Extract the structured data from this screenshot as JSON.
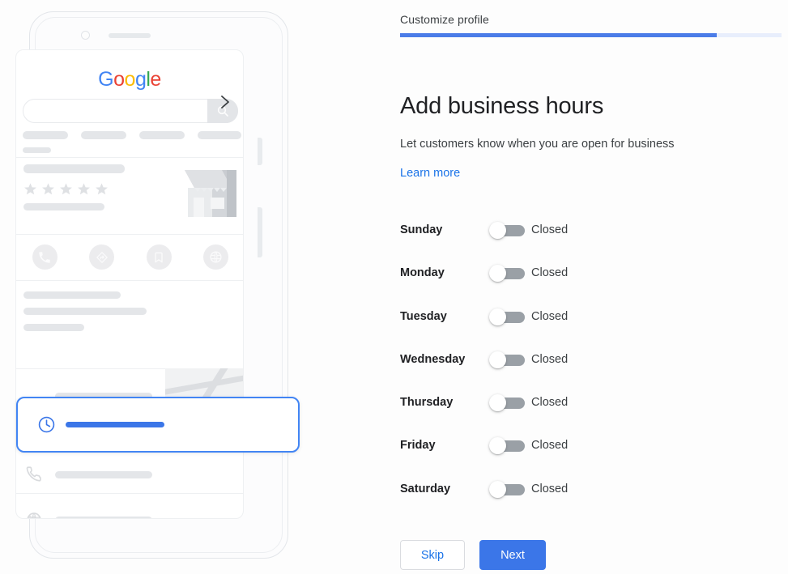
{
  "wizard": {
    "eyebrow": "Customize profile",
    "progress_percent": 83,
    "title": "Add business hours",
    "subtitle": "Let customers know when you are open for business",
    "learn_more_label": "Learn more"
  },
  "hours": {
    "rows": [
      {
        "day": "Sunday",
        "state": "Closed",
        "enabled": false
      },
      {
        "day": "Monday",
        "state": "Closed",
        "enabled": false
      },
      {
        "day": "Tuesday",
        "state": "Closed",
        "enabled": false
      },
      {
        "day": "Wednesday",
        "state": "Closed",
        "enabled": false
      },
      {
        "day": "Thursday",
        "state": "Closed",
        "enabled": false
      },
      {
        "day": "Friday",
        "state": "Closed",
        "enabled": false
      },
      {
        "day": "Saturday",
        "state": "Closed",
        "enabled": false
      }
    ]
  },
  "actions": {
    "skip_label": "Skip",
    "next_label": "Next"
  },
  "illustration": {
    "brand_logo_letters": [
      "G",
      "o",
      "o",
      "g",
      "l",
      "e"
    ],
    "search_icon": "search-icon",
    "rating_stars": 5,
    "storefront_icon": "storefront-icon",
    "action_icons": [
      "phone-icon",
      "directions-icon",
      "bookmark-icon",
      "website-icon"
    ],
    "chevron_icon": "chevron-right-icon",
    "location_icon": "location-pin-icon",
    "map_pin_icon": "map-pin-icon",
    "phone_row_icon": "phone-icon",
    "globe_row_icon": "globe-icon",
    "highlight_card_icon": "clock-icon"
  },
  "colors": {
    "accent_blue": "#3b76e8",
    "link_blue": "#1a73e8",
    "progress_track": "#e8eefc",
    "toggle_off_track": "#9aa0a6",
    "placeholder_grey": "#e4e6e9"
  }
}
